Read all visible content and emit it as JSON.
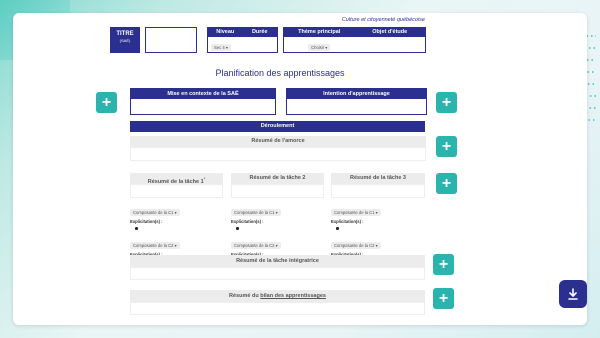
{
  "header": {
    "subject": "Culture et citoyenneté québécoise",
    "title_label": "TITRE",
    "title_sub": "(SAÉ)",
    "columns": {
      "niveau": "Niveau",
      "duree": "Durée",
      "theme": "Thème principal",
      "objet": "Objet d'étude"
    },
    "niveau_value": "Sec 4",
    "theme_value": "Choisir"
  },
  "page_title": "Planification des apprentissages",
  "sections": {
    "mise_en_contexte": "Mise en contexte de la SAÉ",
    "intention": "Intention d'apprentissage",
    "deroulement": "Déroulement",
    "amorce": "Résumé de l'amorce",
    "taches": [
      "Résumé de la tâche 1",
      "Résumé de la tâche 2",
      "Résumé de la tâche 3"
    ],
    "tache_sup": "*",
    "integratrice": "Résumé de la tâche intégratrice",
    "bilan_prefix": "Résumé du ",
    "bilan_link": "bilan des apprentissages"
  },
  "competence": {
    "c1": "Composante de la C1",
    "c2": "Composante de la C2",
    "explicitation": "Explicitation(s) :"
  },
  "colors": {
    "navy": "#2b2f8f",
    "teal": "#2bb3ad"
  },
  "icons": {
    "plus": "+",
    "download": "download-icon"
  }
}
